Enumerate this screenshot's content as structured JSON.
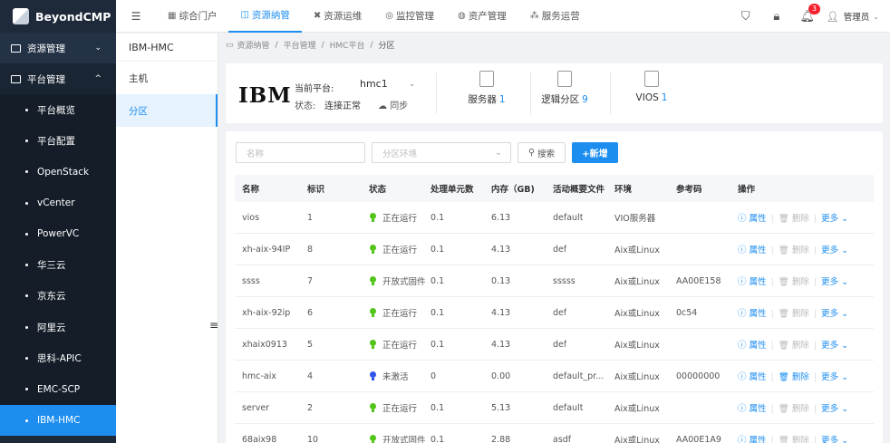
{
  "app": {
    "name": "BeyondCMP"
  },
  "sidebar": {
    "groups": [
      {
        "label": "资源管理",
        "chevron": "⌄"
      },
      {
        "label": "平台管理",
        "chevron": "^"
      }
    ],
    "items": [
      {
        "label": "平台概览"
      },
      {
        "label": "平台配置"
      },
      {
        "label": "OpenStack"
      },
      {
        "label": "vCenter"
      },
      {
        "label": "PowerVC"
      },
      {
        "label": "华三云"
      },
      {
        "label": "京东云"
      },
      {
        "label": "阿里云"
      },
      {
        "label": "思科-APIC"
      },
      {
        "label": "EMC-SCP"
      },
      {
        "label": "IBM-HMC"
      }
    ],
    "active_index": 10
  },
  "topnav": {
    "items": [
      {
        "label": "综合门户",
        "icon": "portal-icon"
      },
      {
        "label": "资源纳管",
        "icon": "resource-icon"
      },
      {
        "label": "资源运维",
        "icon": "ops-icon"
      },
      {
        "label": "监控管理",
        "icon": "monitor-icon"
      },
      {
        "label": "资产管理",
        "icon": "asset-icon"
      },
      {
        "label": "服务运营",
        "icon": "service-icon"
      }
    ],
    "active_index": 1,
    "notification_count": "3",
    "user": "管理员",
    "user_chevron": "⌄"
  },
  "side2": {
    "title": "IBM-HMC",
    "items": [
      {
        "label": "主机"
      },
      {
        "label": "分区"
      }
    ],
    "active_index": 1
  },
  "breadcrumb": [
    "资源纳管",
    "平台管理",
    "HMC平台",
    "分区"
  ],
  "info": {
    "brand": "IBM",
    "platform_label": "当前平台:",
    "platform_value": "hmc1",
    "status_label": "状态:",
    "status_value": "连接正常",
    "sync_label": "同步",
    "stats": [
      {
        "label": "服务器",
        "value": "1"
      },
      {
        "label": "逻辑分区",
        "value": "9"
      },
      {
        "label": "VIOS",
        "value": "1"
      }
    ]
  },
  "filters": {
    "name_placeholder": "名称",
    "env_placeholder": "分区环境",
    "search_label": "搜索",
    "add_label": "+新增"
  },
  "table": {
    "headers": [
      "名称",
      "标识",
      "状态",
      "处理单元数",
      "内存（GB)",
      "活动概要文件",
      "环境",
      "参考码",
      "操作"
    ],
    "rows": [
      {
        "name": "vios",
        "id": "1",
        "status": "正在运行",
        "status_color": "#52c41a",
        "cpu": "0.1",
        "mem": "6.13",
        "profile": "default",
        "env": "VIO服务器",
        "ref": "",
        "del_enabled": false
      },
      {
        "name": "xh-aix-94IP",
        "id": "8",
        "status": "正在运行",
        "status_color": "#52c41a",
        "cpu": "0.1",
        "mem": "4.13",
        "profile": "def",
        "env": "Aix或Linux",
        "ref": "",
        "del_enabled": false
      },
      {
        "name": "ssss",
        "id": "7",
        "status": "开放式固件",
        "status_color": "#52c41a",
        "cpu": "0.1",
        "mem": "0.13",
        "profile": "sssss",
        "env": "Aix或Linux",
        "ref": "AA00E158",
        "del_enabled": false
      },
      {
        "name": "xh-aix-92ip",
        "id": "6",
        "status": "正在运行",
        "status_color": "#52c41a",
        "cpu": "0.1",
        "mem": "4.13",
        "profile": "def",
        "env": "Aix或Linux",
        "ref": "0c54",
        "del_enabled": false
      },
      {
        "name": "xhaix0913",
        "id": "5",
        "status": "正在运行",
        "status_color": "#52c41a",
        "cpu": "0.1",
        "mem": "4.13",
        "profile": "def",
        "env": "Aix或Linux",
        "ref": "",
        "del_enabled": false
      },
      {
        "name": "hmc-aix",
        "id": "4",
        "status": "未激活",
        "status_color": "#2f54eb",
        "cpu": "0",
        "mem": "0.00",
        "profile": "default_pr...",
        "env": "Aix或Linux",
        "ref": "00000000",
        "del_enabled": true
      },
      {
        "name": "server",
        "id": "2",
        "status": "正在运行",
        "status_color": "#52c41a",
        "cpu": "0.1",
        "mem": "5.13",
        "profile": "default",
        "env": "Aix或Linux",
        "ref": "",
        "del_enabled": false
      },
      {
        "name": "68aix98",
        "id": "10",
        "status": "开放式固件",
        "status_color": "#52c41a",
        "cpu": "0.1",
        "mem": "2.88",
        "profile": "asdf",
        "env": "Aix或Linux",
        "ref": "AA00E1A9",
        "del_enabled": false
      }
    ],
    "op_props": "属性",
    "op_delete": "删除",
    "op_more": "更多"
  }
}
